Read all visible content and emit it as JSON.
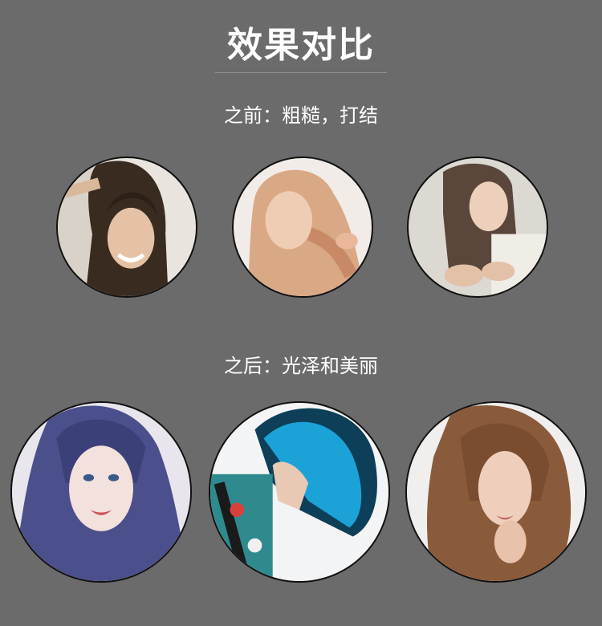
{
  "title": "效果对比",
  "before": {
    "label": "之前：粗糙，打结",
    "photos": [
      "messy-hair-woman-1",
      "blonde-tangled-hair-woman",
      "split-ends-woman"
    ]
  },
  "after": {
    "label": "之后：光泽和美丽",
    "photos": [
      "blue-violet-hair-woman",
      "teal-bob-hair-woman",
      "brown-curly-hair-woman"
    ]
  },
  "colors": {
    "background": "#6b6b6b",
    "text": "#ffffff",
    "divider": "#8f8f8f"
  }
}
